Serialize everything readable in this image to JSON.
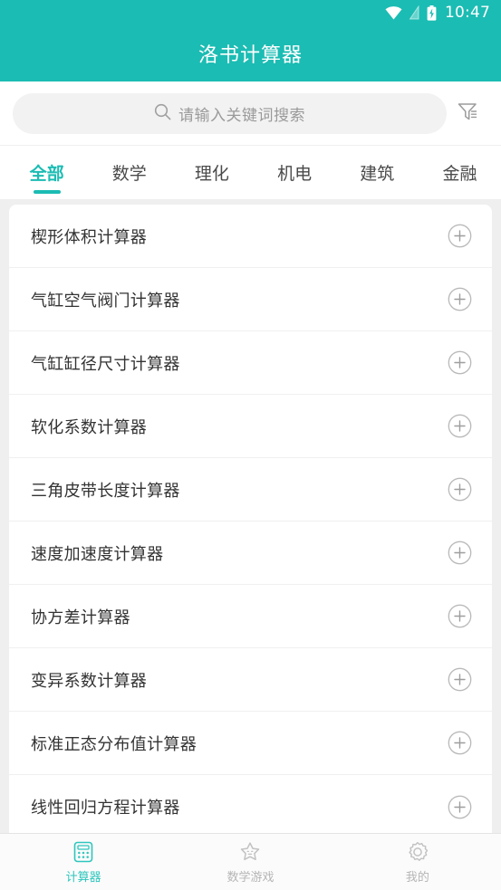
{
  "theme": {
    "accent": "#1bbcb3",
    "accent_light": "#2ec6bd",
    "page_bg": "#efefef",
    "card_bg": "#ffffff",
    "text_primary": "#333333",
    "text_muted": "#9a9a9a",
    "nav_inactive": "#b5b5b5"
  },
  "statusbar": {
    "time": "10:47",
    "icons": [
      "wifi-icon",
      "signal-icon",
      "battery-charging-icon"
    ]
  },
  "header": {
    "title": "洛书计算器"
  },
  "search": {
    "placeholder": "请输入关键词搜索",
    "value": "",
    "icon": "search-icon",
    "filter_icon": "filter-icon"
  },
  "tabs": [
    {
      "label": "全部",
      "active": true
    },
    {
      "label": "数学",
      "active": false
    },
    {
      "label": "理化",
      "active": false
    },
    {
      "label": "机电",
      "active": false
    },
    {
      "label": "建筑",
      "active": false
    },
    {
      "label": "金融",
      "active": false
    }
  ],
  "list": {
    "add_icon": "plus-circle-icon",
    "items": [
      {
        "name": "楔形体积计算器"
      },
      {
        "name": "气缸空气阀门计算器"
      },
      {
        "name": "气缸缸径尺寸计算器"
      },
      {
        "name": "软化系数计算器"
      },
      {
        "name": "三角皮带长度计算器"
      },
      {
        "name": "速度加速度计算器"
      },
      {
        "name": "协方差计算器"
      },
      {
        "name": "变异系数计算器"
      },
      {
        "name": "标准正态分布值计算器"
      },
      {
        "name": "线性回归方程计算器"
      }
    ]
  },
  "bottomnav": [
    {
      "label": "计算器",
      "icon": "calculator-icon",
      "active": true
    },
    {
      "label": "数学游戏",
      "icon": "star-face-icon",
      "active": false
    },
    {
      "label": "我的",
      "icon": "gear-icon",
      "active": false
    }
  ]
}
